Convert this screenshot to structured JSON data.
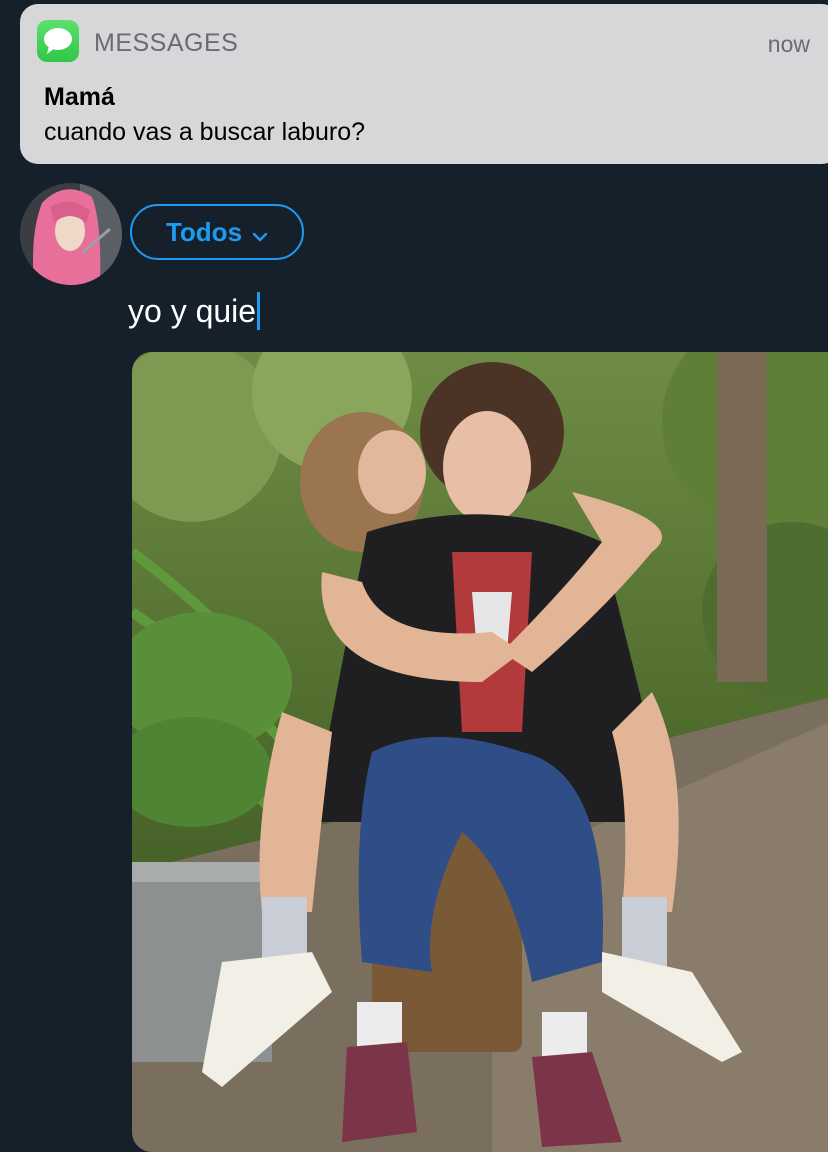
{
  "notification": {
    "app_name": "MESSAGES",
    "time": "now",
    "sender": "Mamá",
    "message": "cuando vas a buscar laburo?",
    "icon": "messages-app-icon"
  },
  "composer": {
    "audience_label": "Todos",
    "text": "yo y quie",
    "accent_color": "#1d9bf0"
  },
  "colors": {
    "background": "#15202b",
    "notification_bg": "#d7d7da"
  }
}
